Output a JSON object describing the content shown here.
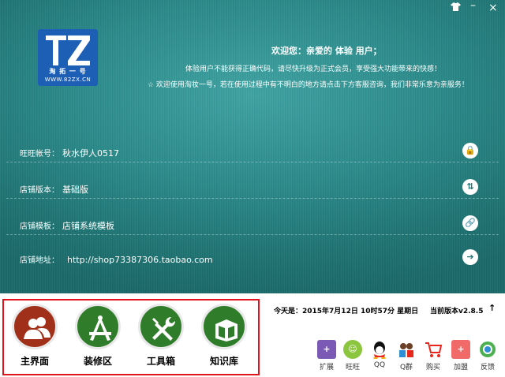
{
  "window": {
    "skin_icon": "shirt-icon",
    "minimize": "–",
    "close": "×"
  },
  "logo": {
    "mark": "TZ",
    "chinese": "淘 拓 一 号",
    "url": "WWW.82ZX.CN"
  },
  "welcome": {
    "title": "欢迎您：亲爱的 体验 用户；",
    "line1": "体验用户不能获得正确代码，请尽快升级为正式会员，享受强大功能带来的快感！",
    "line2": "☆ 欢迎使用淘妆一号，若在使用过程中有不明白的地方请点击下方客服咨询，我们非常乐意为亲服务！"
  },
  "info": [
    {
      "label": "旺旺帐号：",
      "value": "秋水伊人0517",
      "icon": "lock-icon",
      "glyph": "🔒"
    },
    {
      "label": "店铺版本：",
      "value": "基础版",
      "icon": "swap-icon",
      "glyph": "⇅"
    },
    {
      "label": "店铺模板：",
      "value": "店铺系统模板",
      "icon": "link-icon",
      "glyph": "🔗"
    },
    {
      "label": "店铺地址：",
      "value": "http://shop73387306.taobao.com",
      "icon": "arrow-right-icon",
      "glyph": "➔"
    }
  ],
  "nav": [
    {
      "label": "主界面",
      "color": "#a0301a",
      "icon": "users-icon"
    },
    {
      "label": "装修区",
      "color": "#2f7d2a",
      "icon": "compass-ruler-icon"
    },
    {
      "label": "工具箱",
      "color": "#2f7d2a",
      "icon": "tools-icon"
    },
    {
      "label": "知识库",
      "color": "#2f7d2a",
      "icon": "books-icon"
    }
  ],
  "status": {
    "date": "今天是：2015年7月12日 10时57分 星期日",
    "version": "当前版本v2.8.5",
    "up": "↑"
  },
  "tools": [
    {
      "label": "扩展",
      "color": "#7a5ab5",
      "glyph": "+"
    },
    {
      "label": "旺旺",
      "color": "#8cc63f",
      "glyph": "☺"
    },
    {
      "label": "QQ",
      "color": "#ffffff",
      "glyph": "🐧"
    },
    {
      "label": "Q群",
      "color": "#ffffff",
      "glyph": "👥"
    },
    {
      "label": "购买",
      "color": "#ffffff",
      "glyph": "🛒"
    },
    {
      "label": "加盟",
      "color": "#f06a6a",
      "glyph": "+"
    },
    {
      "label": "反馈",
      "color": "#ffffff",
      "glyph": "◉"
    }
  ]
}
